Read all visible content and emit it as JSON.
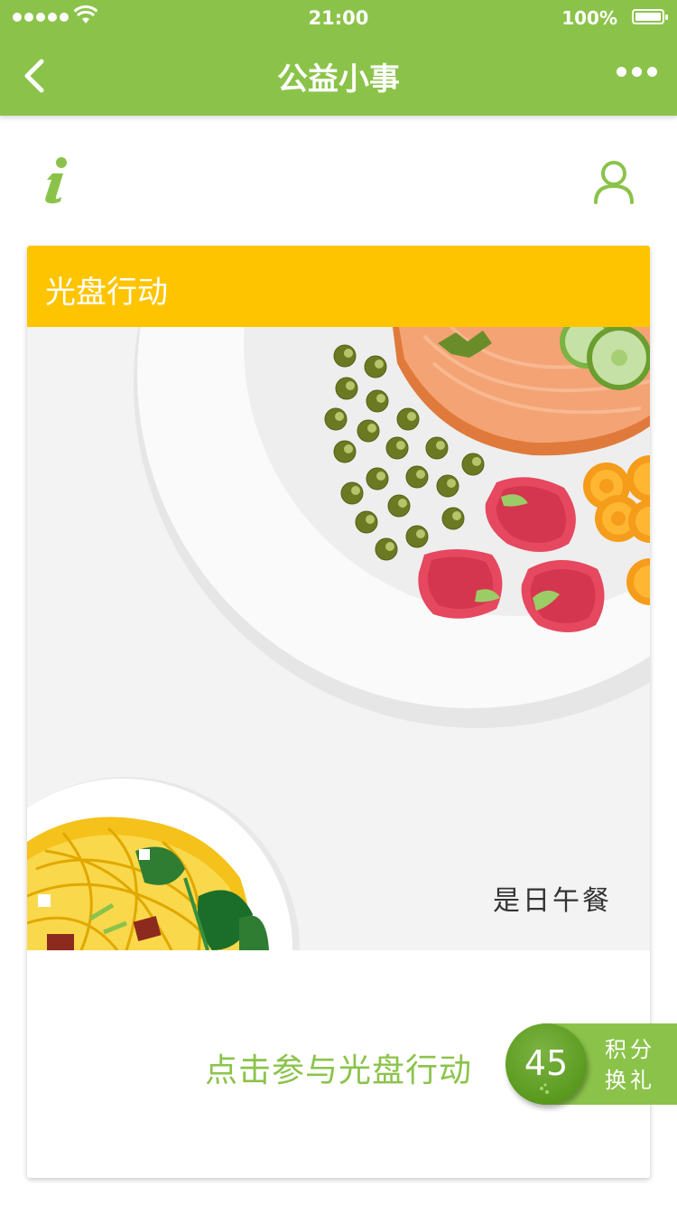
{
  "status_bar": {
    "time": "21:00",
    "battery": "100%"
  },
  "nav": {
    "title": "公益小事"
  },
  "card": {
    "title": "光盘行动",
    "caption": "是日午餐",
    "action_label": "点击参与光盘行动"
  },
  "points": {
    "value": "45",
    "label": "积分换礼"
  },
  "colors": {
    "brand_green": "#8bc34a",
    "header_yellow": "#ffc400",
    "badge_green": "#5a9a1f"
  },
  "icons": [
    "back-arrow-icon",
    "more-dots-icon",
    "info-icon",
    "user-icon",
    "wifi-icon",
    "battery-icon",
    "signal-icon"
  ]
}
